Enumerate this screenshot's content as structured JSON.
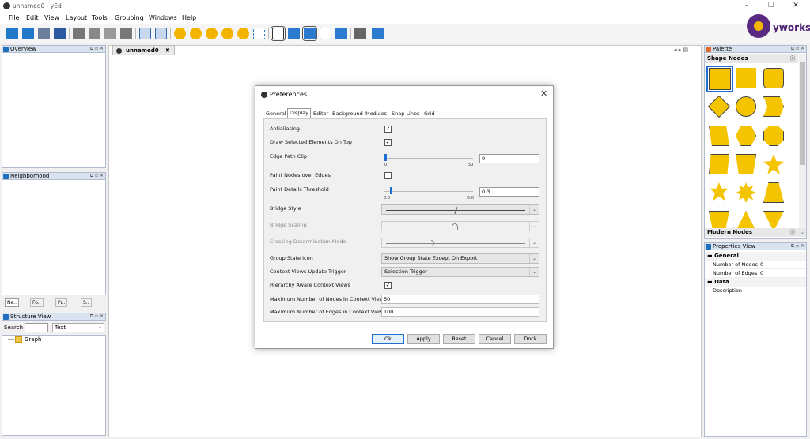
{
  "window": {
    "title": "unnamed0 - yEd"
  },
  "menu": [
    "File",
    "Edit",
    "View",
    "Layout",
    "Tools",
    "Grouping",
    "Windows",
    "Help"
  ],
  "brand": {
    "text": "yworks",
    "color": "#4b1e72"
  },
  "panels": {
    "overview": "Overview",
    "neighborhood": "Neighborhood",
    "structure": "Structure View",
    "palette": "Palette",
    "properties": "Properties View"
  },
  "neighborhood_tabs": [
    "Ne..",
    "Fo..",
    "Pr..",
    "S.."
  ],
  "structure": {
    "search_label": "Search",
    "mode": "Text",
    "tree_root": "Graph"
  },
  "document_tab": "unnamed0",
  "palette": {
    "section1": "Shape Nodes",
    "section2": "Modern Nodes"
  },
  "properties": {
    "general_header": "General",
    "rows": [
      {
        "name": "Number of Nodes",
        "value": "0"
      },
      {
        "name": "Number of Edges",
        "value": "0"
      }
    ],
    "data_header": "Data",
    "description_label": "Description"
  },
  "dialog": {
    "title": "Preferences",
    "tabs": [
      "General",
      "Display",
      "Editor",
      "Background",
      "Modules",
      "Snap Lines",
      "Grid"
    ],
    "active_tab": "Display",
    "settings": {
      "antialiasing": "Antialiasing",
      "draw_selected": "Draw Selected Elements On Top",
      "edge_path_clip": "Edge Path Clip",
      "edge_path_clip_value": "0",
      "edge_path_clip_min": "0",
      "edge_path_clip_max": "50",
      "paint_nodes_over_edges": "Paint Nodes over Edges",
      "paint_details_threshold": "Paint Details Threshold",
      "paint_details_value": "0.3",
      "paint_details_min": "0.0",
      "paint_details_max": "5.0",
      "bridge_style": "Bridge Style",
      "bridge_scaling": "Bridge Scaling",
      "crossing_mode": "Crossing Determination Mode",
      "group_state_icon": "Group State Icon",
      "group_state_value": "Show Group State Except On Export",
      "context_trigger": "Context Views Update Trigger",
      "context_trigger_value": "Selection Trigger",
      "hierarchy_aware": "Hierarchy Aware Context Views",
      "max_nodes": "Maximum Number of Nodes in Context Views",
      "max_nodes_value": "50",
      "max_edges": "Maximum Number of Edges in Context Views",
      "max_edges_value": "100"
    },
    "buttons": {
      "ok": "Ok",
      "apply": "Apply",
      "reset": "Reset",
      "cancel": "Cancel",
      "dock": "Dock"
    }
  }
}
